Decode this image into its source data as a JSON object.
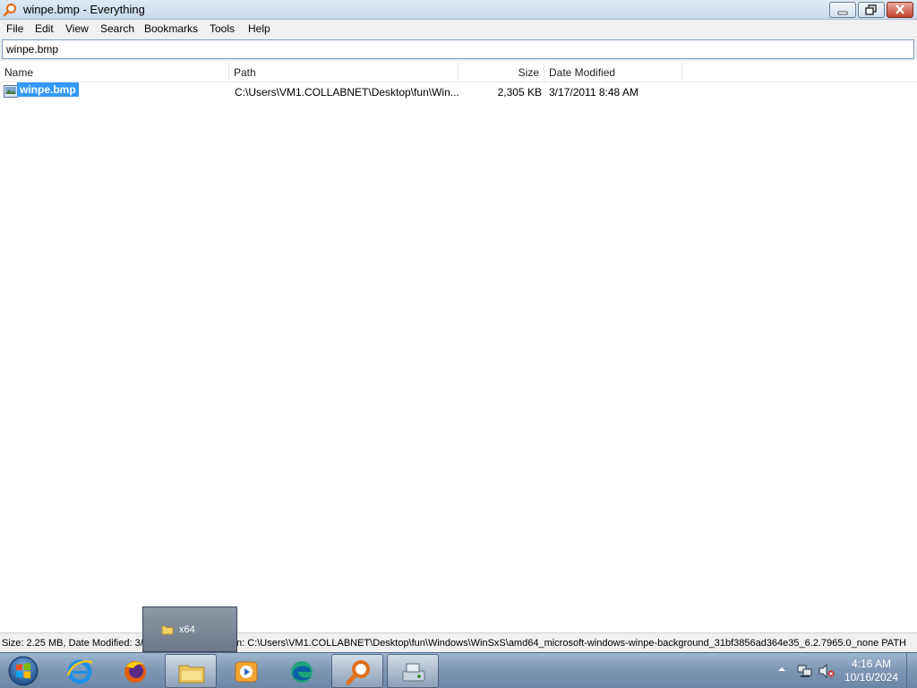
{
  "window": {
    "title": "winpe.bmp - Everything"
  },
  "menu": [
    "File",
    "Edit",
    "View",
    "Search",
    "Bookmarks",
    "Tools",
    "Help"
  ],
  "search": {
    "value": "winpe.bmp"
  },
  "columns": {
    "name": "Name",
    "path": "Path",
    "size": "Size",
    "date": "Date Modified"
  },
  "results": [
    {
      "name": "winpe.bmp",
      "path": "C:\\Users\\VM1.COLLABNET\\Desktop\\fun\\Win...",
      "size": "2,305 KB",
      "date": "3/17/2011 8:48 AM",
      "selected": true
    }
  ],
  "status": {
    "left": "Size: 2.25 MB, Date Modified: 3/",
    "right": "n: C:\\Users\\VM1.COLLABNET\\Desktop\\fun\\Windows\\WinSxS\\amd64_microsoft-windows-winpe-background_31bf3856ad364e35_6.2.7965.0_none  PATH"
  },
  "thumbnail_popup": {
    "label": "x64",
    "icon": "folder-icon"
  },
  "taskbar": {
    "items": [
      {
        "name": "internet-explorer-icon"
      },
      {
        "name": "firefox-icon"
      },
      {
        "name": "file-explorer-icon",
        "active": true
      },
      {
        "name": "media-player-icon"
      },
      {
        "name": "edge-icon"
      },
      {
        "name": "everything-search-icon",
        "active": true
      },
      {
        "name": "control-panel-icon",
        "active": true
      }
    ],
    "clock": {
      "time": "4:16 AM",
      "date": "10/16/2024"
    }
  },
  "colors": {
    "selection": "#3399ff",
    "titlebar": "#dfe9f5",
    "taskbar": "#7f98b5"
  }
}
